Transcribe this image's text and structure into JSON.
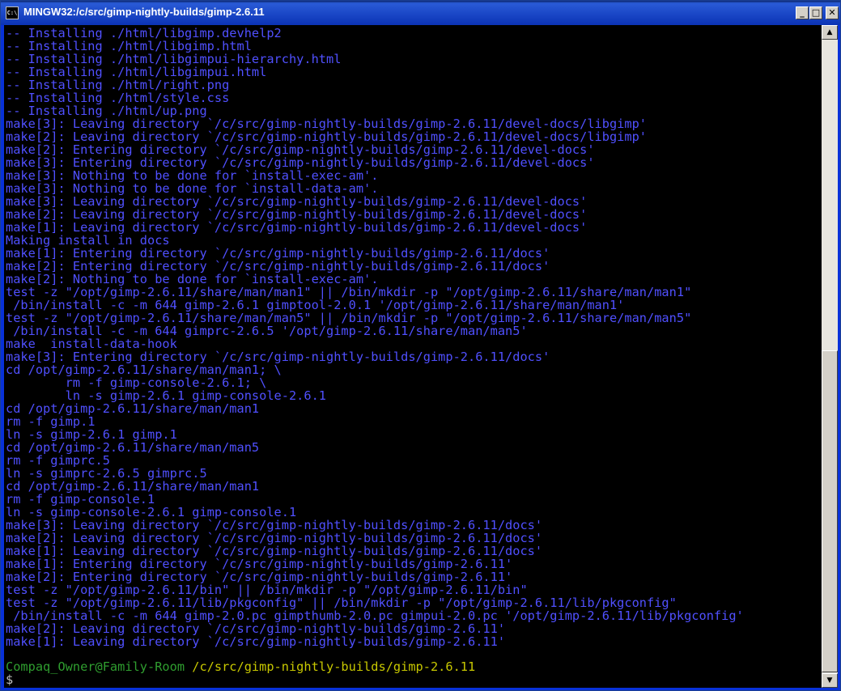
{
  "window": {
    "title": "MINGW32:/c/src/gimp-nightly-builds/gimp-2.6.11",
    "icon_label": "C:\\",
    "buttons": {
      "minimize": "_",
      "maximize": "□",
      "close": "✕"
    },
    "icon": "console-icon"
  },
  "scrollbar": {
    "up_arrow": "▲",
    "down_arrow": "▼"
  },
  "colors": {
    "text": "#5050ff",
    "prompt_user": "#2f9e2f",
    "prompt_path": "#c8c800",
    "background": "#000000"
  },
  "terminal": {
    "lines": [
      "-- Installing ./html/libgimp.devhelp2",
      "-- Installing ./html/libgimp.html",
      "-- Installing ./html/libgimpui-hierarchy.html",
      "-- Installing ./html/libgimpui.html",
      "-- Installing ./html/right.png",
      "-- Installing ./html/style.css",
      "-- Installing ./html/up.png",
      "make[3]: Leaving directory `/c/src/gimp-nightly-builds/gimp-2.6.11/devel-docs/libgimp'",
      "make[2]: Leaving directory `/c/src/gimp-nightly-builds/gimp-2.6.11/devel-docs/libgimp'",
      "make[2]: Entering directory `/c/src/gimp-nightly-builds/gimp-2.6.11/devel-docs'",
      "make[3]: Entering directory `/c/src/gimp-nightly-builds/gimp-2.6.11/devel-docs'",
      "make[3]: Nothing to be done for `install-exec-am'.",
      "make[3]: Nothing to be done for `install-data-am'.",
      "make[3]: Leaving directory `/c/src/gimp-nightly-builds/gimp-2.6.11/devel-docs'",
      "make[2]: Leaving directory `/c/src/gimp-nightly-builds/gimp-2.6.11/devel-docs'",
      "make[1]: Leaving directory `/c/src/gimp-nightly-builds/gimp-2.6.11/devel-docs'",
      "Making install in docs",
      "make[1]: Entering directory `/c/src/gimp-nightly-builds/gimp-2.6.11/docs'",
      "make[2]: Entering directory `/c/src/gimp-nightly-builds/gimp-2.6.11/docs'",
      "make[2]: Nothing to be done for `install-exec-am'.",
      "test -z \"/opt/gimp-2.6.11/share/man/man1\" || /bin/mkdir -p \"/opt/gimp-2.6.11/share/man/man1\"",
      " /bin/install -c -m 644 gimp-2.6.1 gimptool-2.0.1 '/opt/gimp-2.6.11/share/man/man1'",
      "test -z \"/opt/gimp-2.6.11/share/man/man5\" || /bin/mkdir -p \"/opt/gimp-2.6.11/share/man/man5\"",
      " /bin/install -c -m 644 gimprc-2.6.5 '/opt/gimp-2.6.11/share/man/man5'",
      "make  install-data-hook",
      "make[3]: Entering directory `/c/src/gimp-nightly-builds/gimp-2.6.11/docs'",
      "cd /opt/gimp-2.6.11/share/man/man1; \\",
      "        rm -f gimp-console-2.6.1; \\",
      "        ln -s gimp-2.6.1 gimp-console-2.6.1",
      "cd /opt/gimp-2.6.11/share/man/man1",
      "rm -f gimp.1",
      "ln -s gimp-2.6.1 gimp.1",
      "cd /opt/gimp-2.6.11/share/man/man5",
      "rm -f gimprc.5",
      "ln -s gimprc-2.6.5 gimprc.5",
      "cd /opt/gimp-2.6.11/share/man/man1",
      "rm -f gimp-console.1",
      "ln -s gimp-console-2.6.1 gimp-console.1",
      "make[3]: Leaving directory `/c/src/gimp-nightly-builds/gimp-2.6.11/docs'",
      "make[2]: Leaving directory `/c/src/gimp-nightly-builds/gimp-2.6.11/docs'",
      "make[1]: Leaving directory `/c/src/gimp-nightly-builds/gimp-2.6.11/docs'",
      "make[1]: Entering directory `/c/src/gimp-nightly-builds/gimp-2.6.11'",
      "make[2]: Entering directory `/c/src/gimp-nightly-builds/gimp-2.6.11'",
      "test -z \"/opt/gimp-2.6.11/bin\" || /bin/mkdir -p \"/opt/gimp-2.6.11/bin\"",
      "test -z \"/opt/gimp-2.6.11/lib/pkgconfig\" || /bin/mkdir -p \"/opt/gimp-2.6.11/lib/pkgconfig\"",
      " /bin/install -c -m 644 gimp-2.0.pc gimpthumb-2.0.pc gimpui-2.0.pc '/opt/gimp-2.6.11/lib/pkgconfig'",
      "make[2]: Leaving directory `/c/src/gimp-nightly-builds/gimp-2.6.11'",
      "make[1]: Leaving directory `/c/src/gimp-nightly-builds/gimp-2.6.11'",
      ""
    ],
    "prompt": {
      "user_host": "Compaq_Owner@Family-Room",
      "path": " /c/src/gimp-nightly-builds/gimp-2.6.11",
      "symbol": "$"
    }
  }
}
